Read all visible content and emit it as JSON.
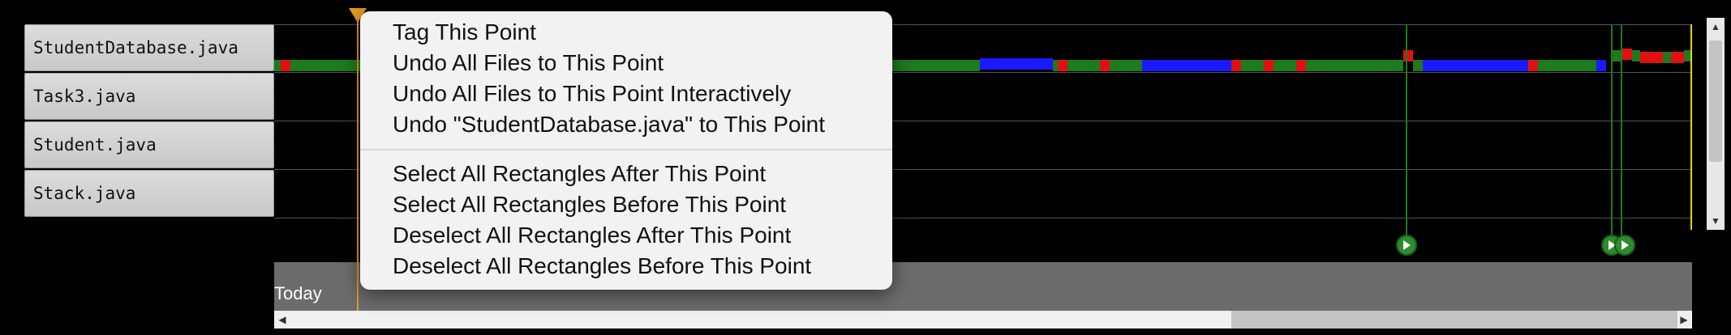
{
  "files": [
    "StudentDatabase.java",
    "Task3.java",
    "Student.java",
    "Stack.java"
  ],
  "bottom_label": "Today",
  "colors": {
    "insert": "#1e7a1e",
    "delete": "#e01010",
    "modify": "#1a1aff",
    "cursor": "#e89a20",
    "marker": "#2e8b2e"
  },
  "icons": {
    "marker": "play-icon",
    "scroll_up": "arrow-up-icon",
    "scroll_down": "arrow-down-icon",
    "scroll_left": "arrow-left-icon",
    "scroll_right": "arrow-right-icon"
  },
  "context_menu": {
    "group1": [
      "Tag This Point",
      "Undo All Files to This Point",
      "Undo All Files to This Point Interactively",
      "Undo \"StudentDatabase.java\" to This Point"
    ],
    "group2": [
      "Select All Rectangles After This Point",
      "Select All Rectangles Before This Point",
      "Deselect All Rectangles After This Point",
      "Deselect All Rectangles Before This Point"
    ]
  }
}
